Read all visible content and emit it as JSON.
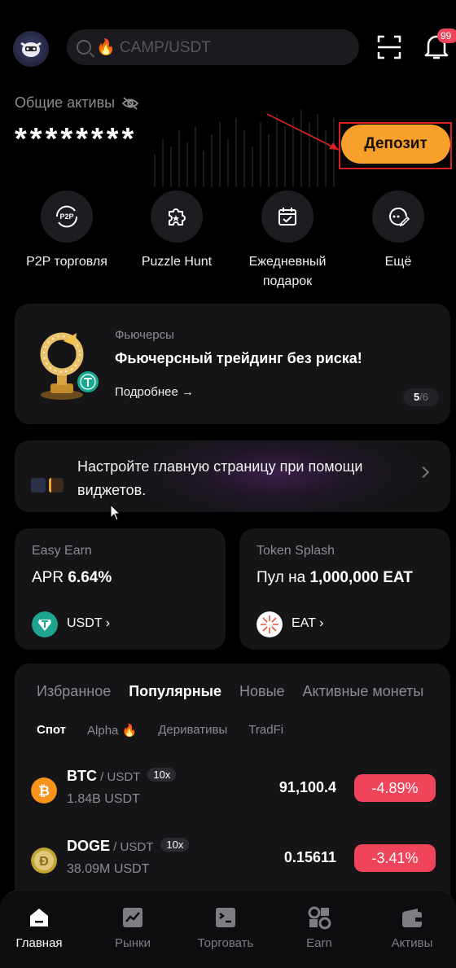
{
  "header": {
    "search_placeholder": "🔥 CAMP/USDT",
    "notification_count": "99"
  },
  "assets": {
    "label": "Общие активы",
    "value": "********",
    "deposit_label": "Депозит"
  },
  "quick_actions": [
    {
      "label": "P2P торговля",
      "icon": "p2p-icon"
    },
    {
      "label": "Puzzle Hunt",
      "icon": "puzzle-icon"
    },
    {
      "label": "Ежедневный подарок",
      "icon": "calendar-check-icon"
    },
    {
      "label": "Ещё",
      "icon": "more-icon"
    }
  ],
  "promo": {
    "category": "Фьючерсы",
    "title": "Фьючерсный трейдинг без риска!",
    "more": "Подробнее →",
    "page_current": "5",
    "page_total": "/6"
  },
  "widget": {
    "text": "Настройте главную страницу при помощи виджетов."
  },
  "earn_cards": [
    {
      "title": "Easy Earn",
      "value_prefix": "APR ",
      "value": "6.64%",
      "coin": "USDT ›"
    },
    {
      "title": "Token Splash",
      "value_prefix": "Пул на ",
      "value": "1,000,000 EAT",
      "coin": "EAT ›"
    }
  ],
  "market": {
    "tabs": [
      "Избранное",
      "Популярные",
      "Новые",
      "Активные монеты"
    ],
    "active_tab": "Популярные",
    "subtabs": [
      "Спот",
      "Alpha 🔥",
      "Деривативы",
      "TradFi"
    ],
    "active_subtab": "Спот",
    "rows": [
      {
        "symbol": "BTC",
        "quote": " / USDT",
        "leverage": "10x",
        "volume": "1.84B USDT",
        "price": "91,100.4",
        "change": "-4.89%"
      },
      {
        "symbol": "DOGE",
        "quote": " / USDT",
        "leverage": "10x",
        "volume": "38.09M USDT",
        "price": "0.15611",
        "change": "-3.41%"
      }
    ]
  },
  "bottom_nav": [
    "Главная",
    "Рынки",
    "Торговать",
    "Earn",
    "Активы"
  ],
  "colors": {
    "accent": "#f7a02b",
    "negative": "#f0445a",
    "background": "#000000",
    "card": "#151518"
  }
}
